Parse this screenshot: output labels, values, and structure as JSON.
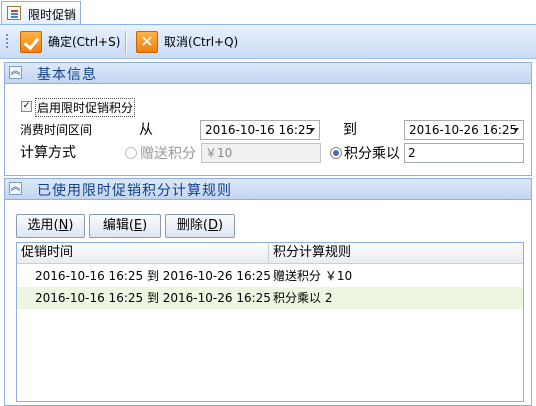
{
  "tab": {
    "label": "限时促销"
  },
  "toolbar": {
    "confirm_label": "确定(Ctrl+S)",
    "cancel_label": "取消(Ctrl+Q)"
  },
  "basic_info": {
    "title": "基本信息",
    "enable_label": "启用限时促销积分",
    "enable_checked": true,
    "period_label": "消费时间区间",
    "from_label": "从",
    "from_value": "2016-10-16 16:25",
    "to_label": "到",
    "to_value": "2016-10-26 16:25",
    "calc_label": "计算方式",
    "gift_points_label": "赠送积分",
    "gift_points_value": "￥10",
    "multiplier_label": "积分乘以",
    "multiplier_value": "2"
  },
  "rules": {
    "title": "已使用限时促销积分计算规则",
    "select_button": "选用(",
    "select_key": "N",
    "edit_button": "编辑(",
    "edit_key": "E",
    "delete_button": "删除(",
    "delete_key": "D",
    "close_paren": ")",
    "columns": [
      "促销时间",
      "积分计算规则"
    ],
    "rows": [
      {
        "time": "2016-10-16 16:25 到 2016-10-26 16:25",
        "rule": "赠送积分 ￥10"
      },
      {
        "time": "2016-10-16 16:25 到 2016-10-26 16:25",
        "rule": "积分乘以 2"
      }
    ]
  }
}
